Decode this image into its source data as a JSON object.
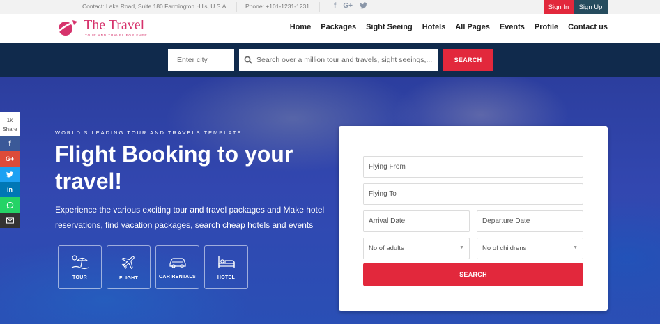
{
  "topbar": {
    "contact": "Contact: Lake Road, Suite 180 Farmington Hills, U.S.A.",
    "phone": "Phone: +101-1231-1231",
    "social_icons": [
      "facebook-icon",
      "google-plus-icon",
      "twitter-icon"
    ],
    "signin_label": "Sign In",
    "signup_label": "Sign Up"
  },
  "header": {
    "logo_title": "The Travel",
    "logo_tagline": "TOUR AND TRAVEL FOR EVER",
    "nav": [
      "Home",
      "Packages",
      "Sight Seeing",
      "Hotels",
      "All Pages",
      "Events",
      "Profile",
      "Contact us"
    ]
  },
  "search_strip": {
    "city_placeholder": "Enter city",
    "tour_placeholder": "Search over a million tour and travels, sight seeings,...",
    "search_label": "SEARCH"
  },
  "hero": {
    "kicker": "WORLD'S LEADING TOUR AND TRAVELS TEMPLATE",
    "headline": "Flight Booking to your travel!",
    "description": "Experience the various exciting tour and travel packages and Make hotel reservations, find vacation packages, search cheap hotels and events",
    "tiles": [
      {
        "label": "TOUR",
        "icon": "beach-umbrella-icon"
      },
      {
        "label": "FLIGHT",
        "icon": "airplane-icon"
      },
      {
        "label": "CAR RENTALS",
        "icon": "car-icon"
      },
      {
        "label": "HOTEL",
        "icon": "bed-icon"
      }
    ]
  },
  "booking_form": {
    "flying_from": "Flying From",
    "flying_to": "Flying To",
    "arrival_date": "Arrival Date",
    "departure_date": "Departure Date",
    "adults": "No of adults",
    "childrens": "No of childrens",
    "search_label": "SEARCH"
  },
  "share": {
    "count": "1k",
    "label": "Share",
    "networks": [
      "facebook-icon",
      "google-plus-icon",
      "twitter-icon",
      "linkedin-icon",
      "whatsapp-icon",
      "email-icon"
    ]
  },
  "colors": {
    "accent_red": "#e2283c",
    "dark_teal": "#264c5e",
    "navy_strip": "#102a4c",
    "logo_pink": "#d6336c"
  }
}
